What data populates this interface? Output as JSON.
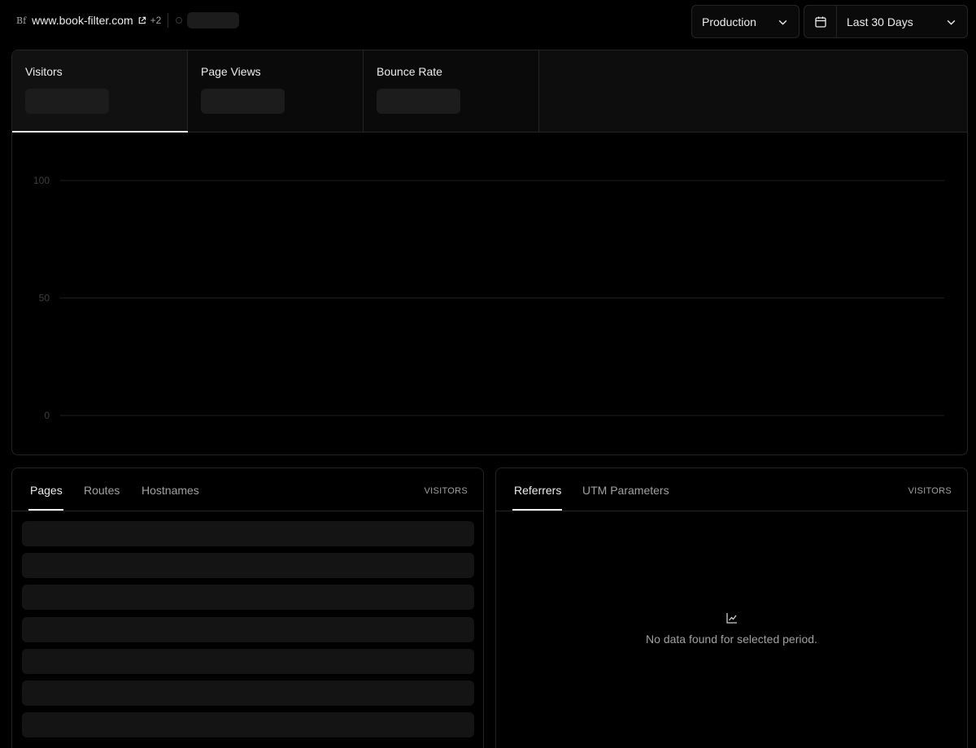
{
  "header": {
    "favicon_text": "Bf",
    "domain": "www.book-filter.com",
    "extra_domains": "+2",
    "environment": "Production",
    "date_range": "Last 30 Days",
    "icons": [
      "external-link-icon",
      "status-dot-icon",
      "chevron-down-icon",
      "calendar-icon"
    ]
  },
  "metrics": [
    {
      "label": "Visitors",
      "active": true
    },
    {
      "label": "Page Views",
      "active": false
    },
    {
      "label": "Bounce Rate",
      "active": false
    }
  ],
  "chart_data": {
    "type": "line",
    "ylim": [
      0,
      100
    ],
    "yticks": [
      100,
      50,
      0
    ],
    "series": [],
    "grid": true
  },
  "pages_panel": {
    "tabs": [
      "Pages",
      "Routes",
      "Hostnames"
    ],
    "active_tab": "Pages",
    "column_header": "VISITORS",
    "loading_rows": 7
  },
  "referrers_panel": {
    "tabs": [
      "Referrers",
      "UTM Parameters"
    ],
    "active_tab": "Referrers",
    "column_header": "VISITORS",
    "empty_message": "No data found for selected period.",
    "empty_icon": "line-chart-icon"
  },
  "colors": {
    "background": "#000000",
    "border": "#242424",
    "text": "#ededed",
    "muted_text": "#a1a1a1",
    "skeleton": "#1c1c1c"
  }
}
